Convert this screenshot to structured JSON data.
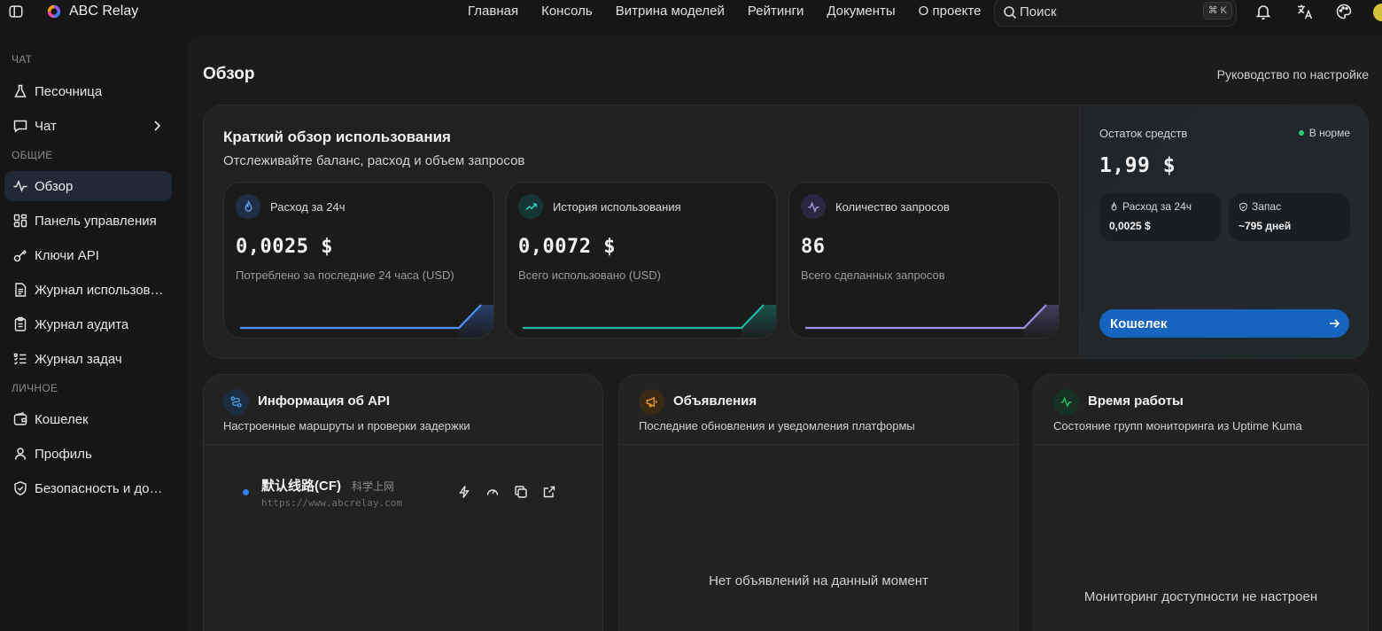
{
  "header": {
    "brand": "ABC Relay",
    "nav": [
      "Главная",
      "Консоль",
      "Витрина моделей",
      "Рейтинги",
      "Документы",
      "О проекте"
    ],
    "search_placeholder": "Поиск",
    "search_shortcut": "⌘ K"
  },
  "sidebar": {
    "sections": [
      {
        "title": "ЧАТ",
        "items": [
          {
            "label": "Песочница",
            "icon": "flask-icon"
          },
          {
            "label": "Чат",
            "icon": "chat-icon",
            "has_chevron": true
          }
        ]
      },
      {
        "title": "ОБЩИЕ",
        "items": [
          {
            "label": "Обзор",
            "icon": "activity-icon",
            "active": true
          },
          {
            "label": "Панель управления",
            "icon": "dashboard-icon"
          },
          {
            "label": "Ключи API",
            "icon": "key-icon"
          },
          {
            "label": "Журнал использов…",
            "icon": "document-icon"
          },
          {
            "label": "Журнал аудита",
            "icon": "clipboard-icon"
          },
          {
            "label": "Журнал задач",
            "icon": "list-icon"
          }
        ]
      },
      {
        "title": "ЛИЧНОЕ",
        "items": [
          {
            "label": "Кошелек",
            "icon": "wallet-icon"
          },
          {
            "label": "Профиль",
            "icon": "user-icon"
          },
          {
            "label": "Безопасность и до…",
            "icon": "shield-icon"
          }
        ]
      }
    ]
  },
  "main": {
    "title": "Обзор",
    "guide_link": "Руководство по настройке",
    "usage": {
      "title": "Краткий обзор использования",
      "subtitle": "Отслеживайте баланс, расход и объем запросов",
      "stats": [
        {
          "label": "Расход за 24ч",
          "value": "0,0025 $",
          "desc": "Потреблено за последние 24 часа (USD)",
          "icon": "flame-icon",
          "color": "#3b82f6"
        },
        {
          "label": "История использования",
          "value": "0,0072 $",
          "desc": "Всего использовано (USD)",
          "icon": "trending-up-icon",
          "color": "#14b8a6"
        },
        {
          "label": "Количество запросов",
          "value": "86",
          "desc": "Всего сделанных запросов",
          "icon": "pulse-icon",
          "color": "#8b7fd6"
        }
      ],
      "balance": {
        "label": "Остаток средств",
        "status": "В норме",
        "value": "1,99 $",
        "spend_label": "Расход за 24ч",
        "spend_value": "0,0025 $",
        "reserve_label": "Запас",
        "reserve_value": "~795 дней",
        "wallet_button": "Кошелек"
      }
    },
    "api_panel": {
      "title": "Информация об API",
      "subtitle": "Настроенные маршруты и проверки задержки",
      "route_name": "默认线路(CF)",
      "route_tag": "科学上网",
      "route_url": "https://www.abcrelay.com"
    },
    "announcements_panel": {
      "title": "Объявления",
      "subtitle": "Последние обновления и уведомления платформы",
      "empty": "Нет объявлений на данный момент"
    },
    "uptime_panel": {
      "title": "Время работы",
      "subtitle": "Состояние групп мониторинга из Uptime Kuma",
      "empty": "Мониторинг доступности не настроен"
    }
  },
  "colors": {
    "accent_blue": "#1565c0",
    "status_green": "#2ecc71",
    "announce_orange": "#e89a2c",
    "uptime_green": "#22c55e"
  }
}
